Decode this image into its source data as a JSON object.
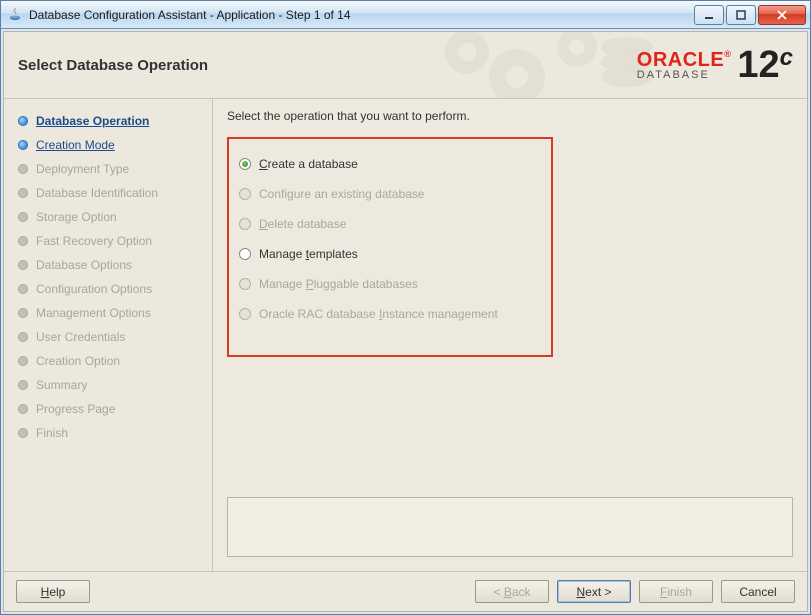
{
  "window": {
    "title": "Database Configuration Assistant - Application - Step 1 of 14"
  },
  "header": {
    "title": "Select Database Operation",
    "brand_oracle": "ORACLE",
    "brand_reg": "®",
    "brand_database": "DATABASE",
    "brand_version_num": "12",
    "brand_version_c": "c"
  },
  "sidebar": {
    "steps": [
      {
        "label": "Database Operation",
        "state": "current"
      },
      {
        "label": "Creation Mode",
        "state": "link"
      },
      {
        "label": "Deployment Type",
        "state": "disabled"
      },
      {
        "label": "Database Identification",
        "state": "disabled"
      },
      {
        "label": "Storage Option",
        "state": "disabled"
      },
      {
        "label": "Fast Recovery Option",
        "state": "disabled"
      },
      {
        "label": "Database Options",
        "state": "disabled"
      },
      {
        "label": "Configuration Options",
        "state": "disabled"
      },
      {
        "label": "Management Options",
        "state": "disabled"
      },
      {
        "label": "User Credentials",
        "state": "disabled"
      },
      {
        "label": "Creation Option",
        "state": "disabled"
      },
      {
        "label": "Summary",
        "state": "disabled"
      },
      {
        "label": "Progress Page",
        "state": "disabled"
      },
      {
        "label": "Finish",
        "state": "disabled"
      }
    ]
  },
  "content": {
    "instruction": "Select the operation that you want to perform.",
    "options": [
      {
        "pre": "",
        "mn": "C",
        "post": "reate a database",
        "enabled": true,
        "selected": true
      },
      {
        "pre": "Confi",
        "mn": "g",
        "post": "ure an existing database",
        "enabled": false,
        "selected": false
      },
      {
        "pre": "",
        "mn": "D",
        "post": "elete database",
        "enabled": false,
        "selected": false
      },
      {
        "pre": "Manage ",
        "mn": "t",
        "post": "emplates",
        "enabled": true,
        "selected": false
      },
      {
        "pre": "Manage ",
        "mn": "P",
        "post": "luggable databases",
        "enabled": false,
        "selected": false
      },
      {
        "pre": "Oracle RAC database ",
        "mn": "I",
        "post": "nstance management",
        "enabled": false,
        "selected": false
      }
    ]
  },
  "footer": {
    "help_mn": "H",
    "help_post": "elp",
    "back_pre": "< ",
    "back_mn": "B",
    "back_post": "ack",
    "next_mn": "N",
    "next_post": "ext >",
    "finish_mn": "F",
    "finish_post": "inish",
    "cancel": "Cancel"
  }
}
